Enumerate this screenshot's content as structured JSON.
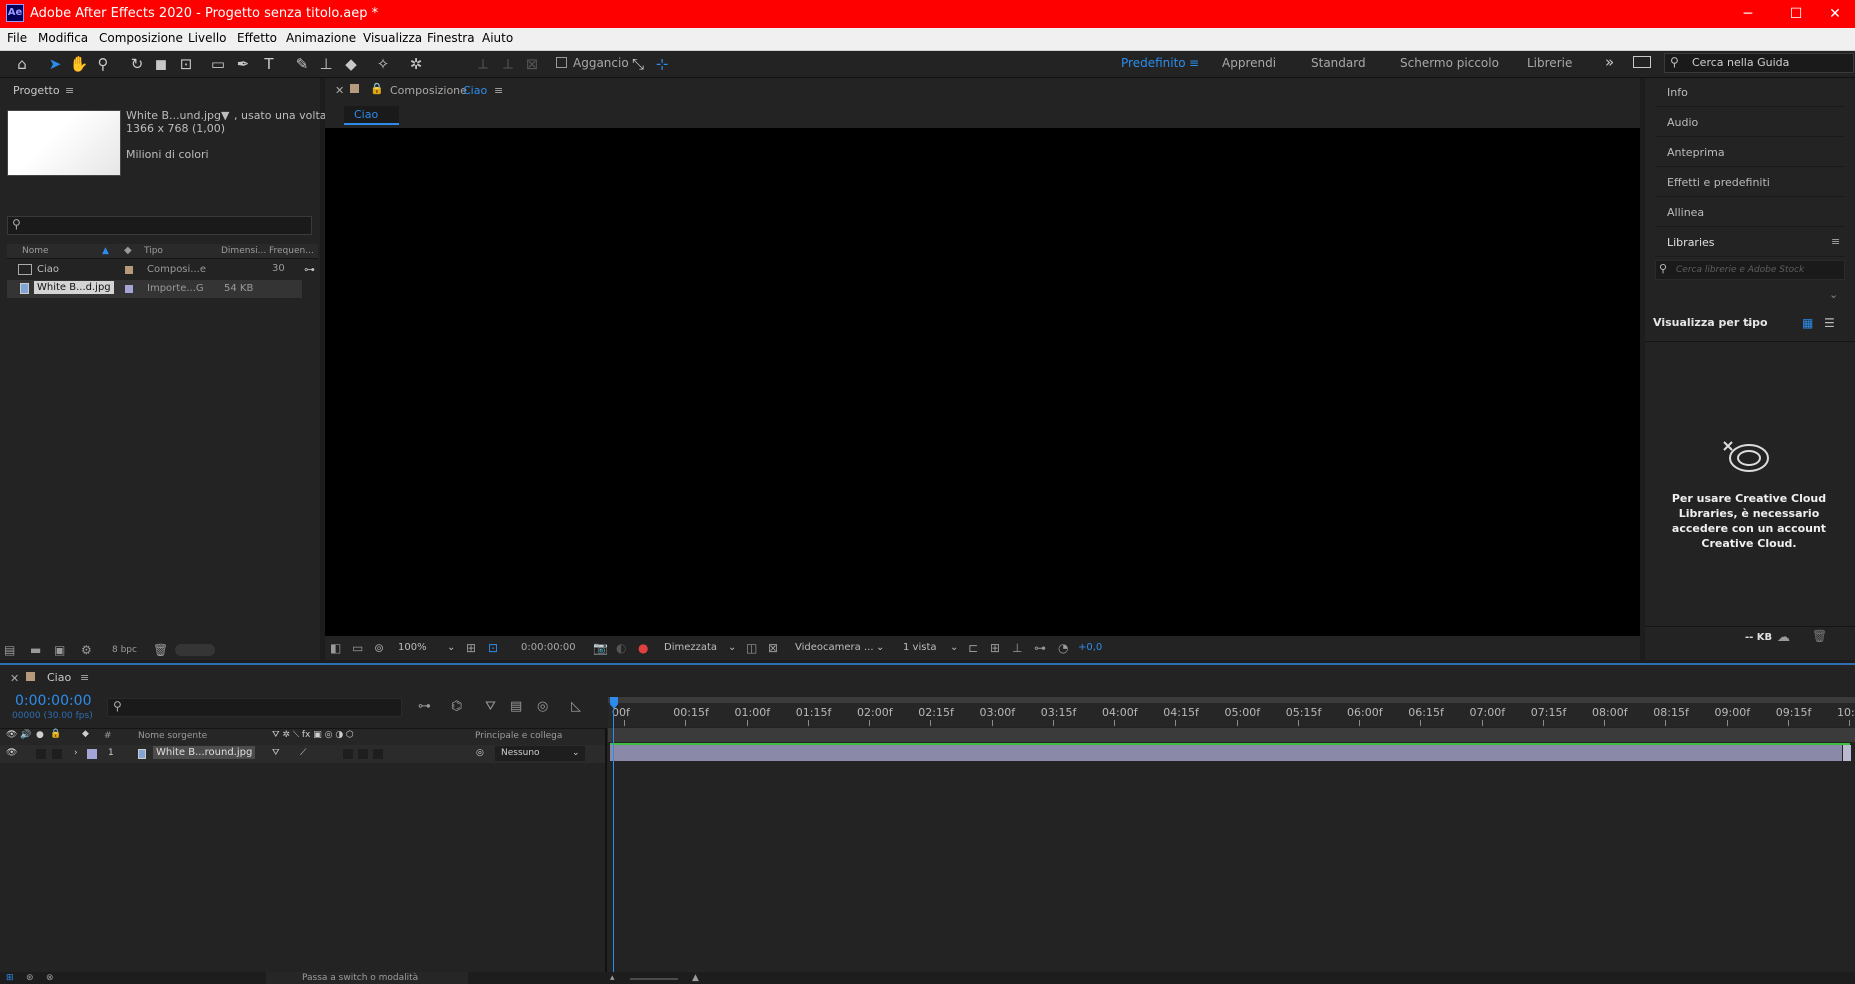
{
  "title_bar": {
    "app_badge": "Ae",
    "title": "Adobe After Effects 2020 - Progetto senza titolo.aep *",
    "minimize": "─",
    "maximize": "☐",
    "close": "✕"
  },
  "menu": [
    "File",
    "Modifica",
    "Composizione",
    "Livello",
    "Effetto",
    "Animazione",
    "Visualizza",
    "Finestra",
    "Aiuto"
  ],
  "toolbar": {
    "snap_label": "Aggancio",
    "workspaces": [
      "Predefinito",
      "Apprendi",
      "Standard",
      "Schermo piccolo",
      "Librerie"
    ],
    "more": "»",
    "help_placeholder": "Cerca nella Guida"
  },
  "project": {
    "panel_title": "Progetto",
    "preview": {
      "name": "White B...und.jpg",
      "usage": ", usato una volta",
      "size": "1366 x 768 (1,00)",
      "colors": "Milioni di colori"
    },
    "columns": [
      "Nome",
      "Tipo",
      "Dimensi...",
      "Frequen..."
    ],
    "items": [
      {
        "name": "Ciao",
        "type": "Composi...e",
        "size": "",
        "fps": "30",
        "label_color": "#b59b7c"
      },
      {
        "name": "White B...d.jpg",
        "type": "Importe...G",
        "size": "54 KB",
        "fps": "",
        "label_color": "#a4a4d7"
      }
    ],
    "bpc": "8 bpc"
  },
  "composition": {
    "panel_prefix": "Composizione",
    "comp_name": "Ciao",
    "tab": "Ciao",
    "zoom": "100%",
    "timecode": "0:00:00:00",
    "resolution": "Dimezzata",
    "camera": "Videocamera ...",
    "views": "1 vista",
    "exposure": "+0,0"
  },
  "right_panels": {
    "items": [
      "Info",
      "Audio",
      "Anteprima",
      "Effetti e predefiniti",
      "Allinea"
    ],
    "libraries_title": "Libraries",
    "libraries_search": "Cerca librerie e Adobe Stock",
    "view_by": "Visualizza per tipo",
    "cc_message": "Per usare Creative Cloud Libraries, è necessario accedere con un account Creative Cloud.",
    "storage": "-- KB"
  },
  "timeline": {
    "tab": "Ciao",
    "timecode": "0:00:00:00",
    "frames": "00000 (30.00 fps)",
    "columns": {
      "num": "#",
      "source": "Nome sorgente",
      "parent": "Principale e collega"
    },
    "ruler": [
      "00f",
      "00:15f",
      "01:00f",
      "01:15f",
      "02:00f",
      "02:15f",
      "03:00f",
      "03:15f",
      "04:00f",
      "04:15f",
      "05:00f",
      "05:15f",
      "06:00f",
      "06:15f",
      "07:00f",
      "07:15f",
      "08:00f",
      "08:15f",
      "09:00f",
      "09:15f",
      "10:0"
    ],
    "layers": [
      {
        "num": "1",
        "name": "White B...round.jpg",
        "parent": "Nessuno",
        "label_color": "#a4a4d7"
      }
    ],
    "footer": "Passa a switch o modalità"
  },
  "colors": {
    "accent": "#2d8ceb",
    "titlebar": "#ff0000",
    "layer_bar": "#8a89a8"
  }
}
